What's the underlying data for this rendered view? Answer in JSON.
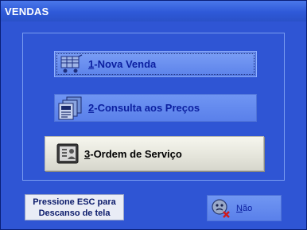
{
  "window": {
    "title": "VENDAS"
  },
  "menu": {
    "nova_venda": {
      "hotkey": "1",
      "text": "-Nova Venda"
    },
    "consulta_precos": {
      "hotkey": "2",
      "text": "-Consulta aos Preços"
    },
    "ordem_servico": {
      "hotkey": "3",
      "text": "-Ordem de Serviço"
    }
  },
  "footer": {
    "notice_line1": "Pressione ESC para",
    "notice_line2": "Descanso de tela",
    "nao_hotkey": "N",
    "nao_text": "ão"
  },
  "icons": {
    "nova_venda": "cart-icon",
    "consulta_precos": "documents-icon",
    "ordem_servico": "work-order-icon",
    "nao": "cancel-icon"
  },
  "colors": {
    "window_bg": "#2f55d4",
    "titlebar": "#3a64dd",
    "button_text": "#0b1fa0",
    "selected_button_bg": "#eeeee4"
  }
}
